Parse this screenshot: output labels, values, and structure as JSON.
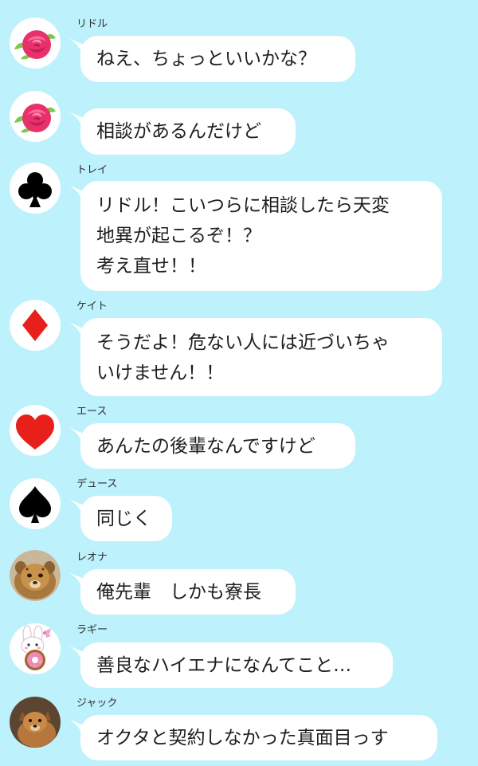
{
  "messages": [
    {
      "sender": "リドル",
      "text": "ねえ、ちょっといいかな？",
      "avatar": "rose-icon"
    },
    {
      "sender": "",
      "text": "相談があるんだけど",
      "avatar": "rose-icon"
    },
    {
      "sender": "トレイ",
      "text": "リドル！こいつらに相談したら天変\n地異が起こるぞ！？\n考え直せ！！",
      "avatar": "club-suit-icon"
    },
    {
      "sender": "ケイト",
      "text": "そうだよ！危ない人には近づいちゃ\nいけません！！",
      "avatar": "diamond-suit-icon"
    },
    {
      "sender": "エース",
      "text": "あんたの後輩なんですけど",
      "avatar": "heart-suit-icon"
    },
    {
      "sender": "デュース",
      "text": "同じく",
      "avatar": "spade-suit-icon"
    },
    {
      "sender": "レオナ",
      "text": "俺先輩　しかも寮長",
      "avatar": "lion-cub-icon"
    },
    {
      "sender": "ラギー",
      "text": "善良なハイエナになんてこと…",
      "avatar": "bunny-donut-icon"
    },
    {
      "sender": "ジャック",
      "text": "オクタと契約しなかった真面目っす",
      "avatar": "dog-icon"
    }
  ],
  "colors": {
    "background": "#bdf1fb",
    "bubble": "#ffffff",
    "rose": "#e8306a",
    "leaf": "#7cc84e",
    "club": "#000000",
    "spade": "#000000",
    "diamond": "#e8201c",
    "heart": "#e8201c"
  }
}
